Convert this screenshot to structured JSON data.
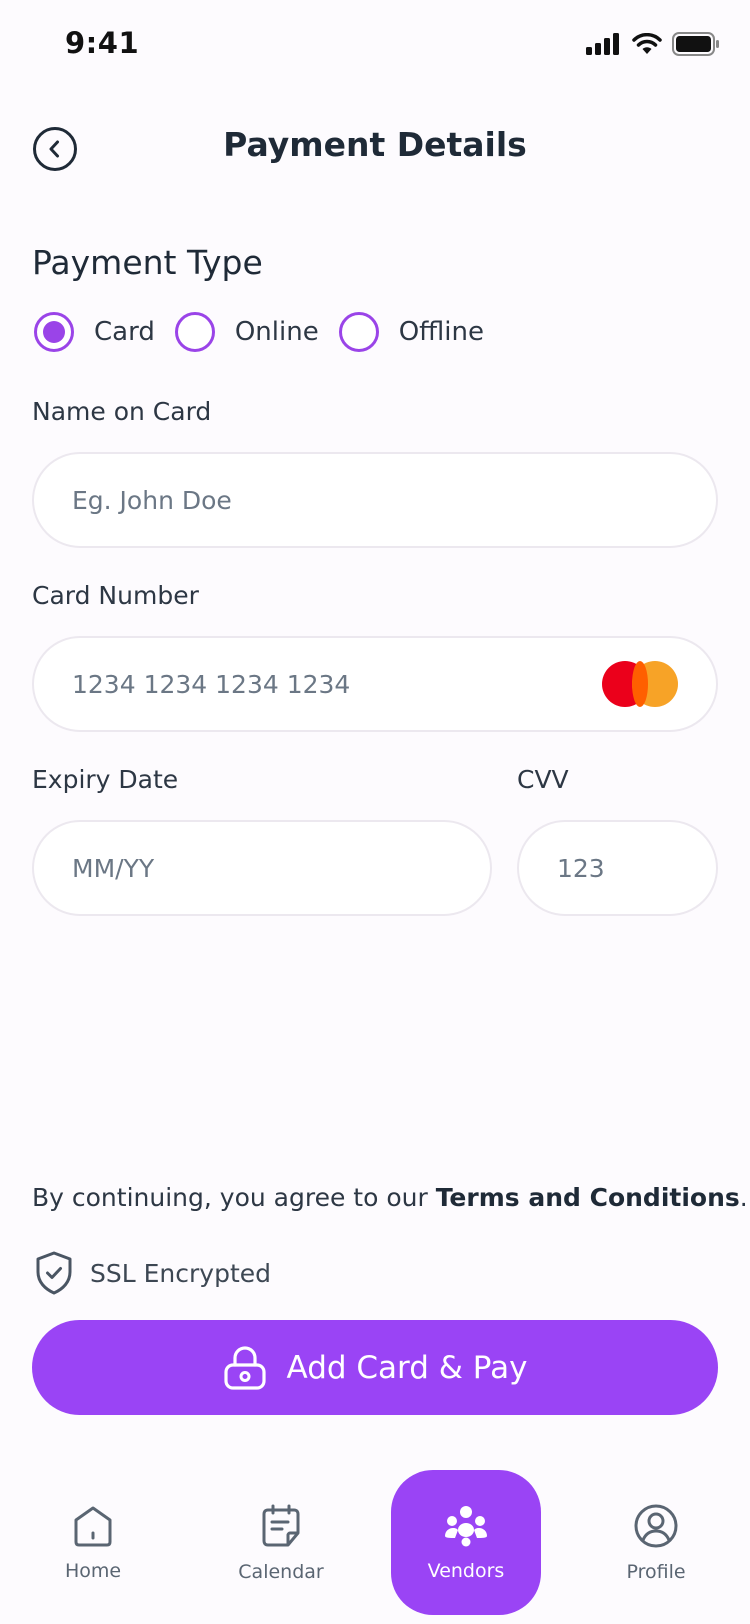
{
  "status_bar": {
    "time": "9:41"
  },
  "header": {
    "title": "Payment Details"
  },
  "payment_type": {
    "title": "Payment Type",
    "selected": "Card",
    "options": [
      "Card",
      "Online",
      "Offline"
    ]
  },
  "form": {
    "name": {
      "label": "Name on Card",
      "placeholder": "Eg. John Doe"
    },
    "card_number": {
      "label": "Card Number",
      "placeholder": "1234 1234 1234 1234"
    },
    "expiry": {
      "label": "Expiry Date",
      "placeholder": "MM/YY"
    },
    "cvv": {
      "label": "CVV",
      "placeholder": "123"
    }
  },
  "terms": {
    "prefix": "By continuing, you agree to our ",
    "link": "Terms and Conditions",
    "suffix": "."
  },
  "ssl": {
    "label": "SSL Encrypted"
  },
  "pay_button": {
    "label": "Add Card & Pay"
  },
  "nav": {
    "items": [
      {
        "label": "Home",
        "icon": "home-icon"
      },
      {
        "label": "Calendar",
        "icon": "calendar-icon"
      },
      {
        "label": "Vendors",
        "icon": "vendors-icon"
      },
      {
        "label": "Profile",
        "icon": "profile-icon"
      }
    ],
    "active": "Vendors"
  },
  "colors": {
    "accent": "#9a44f5",
    "text": "#1f2a37",
    "background": "#fdfbfe"
  }
}
